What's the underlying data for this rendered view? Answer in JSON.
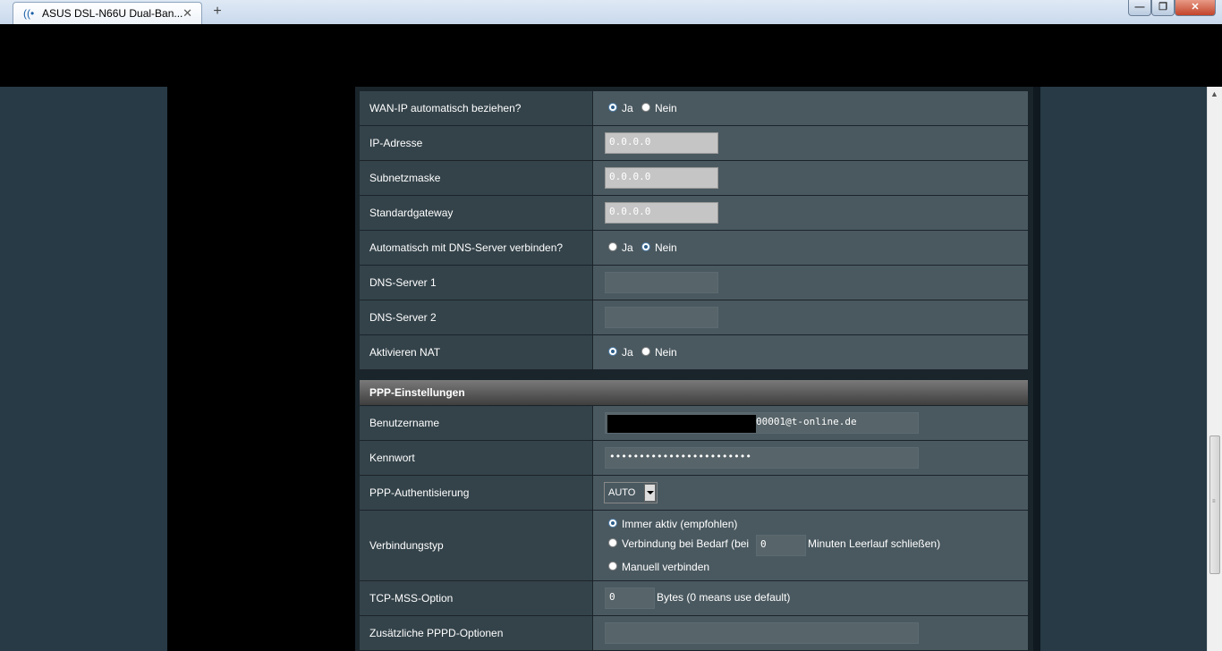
{
  "browser": {
    "tab_title": "ASUS DSL-N66U Dual-Ban...",
    "tab_close": "✕",
    "new_tab": "+",
    "min_btn": "—",
    "max_btn": "❐",
    "close_btn": "✕"
  },
  "wan": {
    "auto_ip_label": "WAN-IP automatisch beziehen?",
    "auto_ip_yes": "Ja",
    "auto_ip_no": "Nein",
    "auto_ip_selected": "Ja",
    "ip_label": "IP-Adresse",
    "ip_value": "0.0.0.0",
    "subnet_label": "Subnetzmaske",
    "subnet_value": "0.0.0.0",
    "gateway_label": "Standardgateway",
    "gateway_value": "0.0.0.0",
    "auto_dns_label": "Automatisch mit DNS-Server verbinden?",
    "auto_dns_yes": "Ja",
    "auto_dns_no": "Nein",
    "auto_dns_selected": "Nein",
    "dns1_label": "DNS-Server 1",
    "dns1_value": "",
    "dns2_label": "DNS-Server 2",
    "dns2_value": "",
    "nat_label": "Aktivieren NAT",
    "nat_yes": "Ja",
    "nat_no": "Nein",
    "nat_selected": "Ja"
  },
  "ppp": {
    "section_title": "PPP-Einstellungen",
    "username_label": "Benutzername",
    "username_visible": "00001@t-online.de",
    "password_label": "Kennwort",
    "password_value": "••••••••••••••••••••••••",
    "auth_label": "PPP-Authentisierung",
    "auth_value": "AUTO",
    "conn_type_label": "Verbindungstyp",
    "conn_always": "Immer aktiv (empfohlen)",
    "conn_demand_pre": "Verbindung bei Bedarf (bei",
    "conn_demand_value": "0",
    "conn_demand_post": "Minuten Leerlauf schließen)",
    "conn_manual": "Manuell verbinden",
    "conn_selected": "always",
    "mss_label": "TCP-MSS-Option",
    "mss_value": "0",
    "mss_suffix": "Bytes (0 means use default)",
    "pppd_label": "Zusätzliche PPPD-Optionen",
    "pppd_value": ""
  }
}
